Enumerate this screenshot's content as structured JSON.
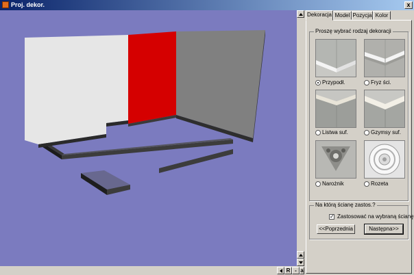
{
  "window": {
    "title": "Proj. dekor.",
    "close_label": "x"
  },
  "tabs": [
    {
      "label": "Dekoracja",
      "active": true
    },
    {
      "label": "Model",
      "active": false
    },
    {
      "label": "Pozycja",
      "active": false
    },
    {
      "label": "Kolor",
      "active": false
    }
  ],
  "decoration_group": {
    "legend": "Proszę wybrać rodzaj dekoracji",
    "options": [
      {
        "label": "Przypodł.",
        "selected": true
      },
      {
        "label": "Fryz ści.",
        "selected": false
      },
      {
        "label": "Listwa suf.",
        "selected": false
      },
      {
        "label": "Gzymsy suf.",
        "selected": false
      },
      {
        "label": "Narożnik",
        "selected": false
      },
      {
        "label": "Rozeta",
        "selected": false
      }
    ]
  },
  "wall_group": {
    "legend": "Na którą ścianę zastos.?",
    "checkbox_label": "Zastosować na wybraną ścianę",
    "checkbox_checked": true,
    "prev_button": "<<Poprzednia",
    "next_button": "Następna>>"
  },
  "view_controls": {
    "r_label": "R",
    "minus_label": "-",
    "a_label": "a"
  },
  "scene_colors": {
    "background": "#7b7bbf",
    "selected_wall": "#d50000",
    "wall": "#808080",
    "textured_wall": "#e6e6e6"
  }
}
